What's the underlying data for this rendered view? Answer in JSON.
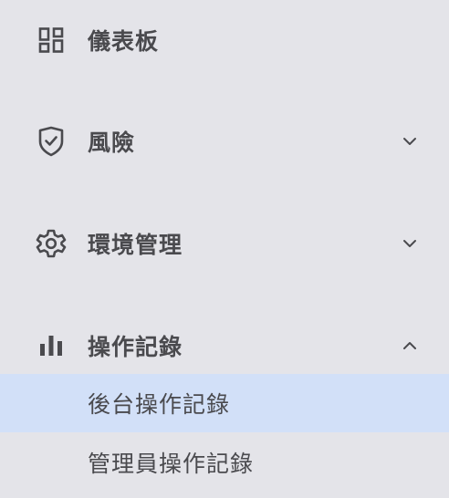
{
  "sidebar": {
    "items": [
      {
        "label": "儀表板",
        "icon": "dashboard-icon",
        "expandable": false
      },
      {
        "label": "風險",
        "icon": "shield-check-icon",
        "expandable": true,
        "expanded": false
      },
      {
        "label": "環境管理",
        "icon": "gear-icon",
        "expandable": true,
        "expanded": false
      },
      {
        "label": "操作記錄",
        "icon": "bar-chart-icon",
        "expandable": true,
        "expanded": true,
        "children": [
          {
            "label": "後台操作記錄",
            "active": true
          },
          {
            "label": "管理員操作記錄",
            "active": false
          }
        ]
      }
    ]
  },
  "colors": {
    "background": "#e4e4e9",
    "active_background": "#d2e0f8",
    "text": "#4a4a4e"
  }
}
